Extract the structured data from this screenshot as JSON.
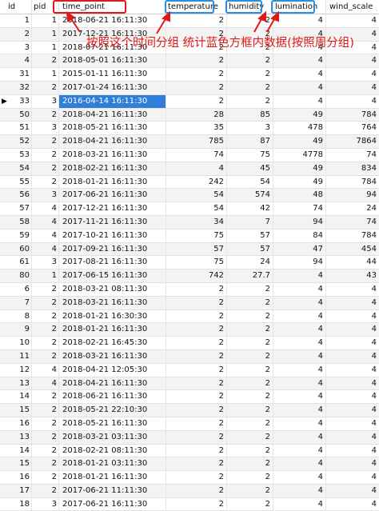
{
  "columns": {
    "id": "id",
    "pid": "pid",
    "time_point": "time_point",
    "temperature": "temperature",
    "humidity": "humidity",
    "lumination": "lumination",
    "wind_scale": "wind_scale"
  },
  "annotation": "按照这个时间分组 统计蓝色方框内数据(按照周分组)",
  "selected_row_index": 6,
  "highlight_colors": {
    "time_point_box": "#e01818",
    "data_boxes": "#2a8fe0",
    "selection": "#2f7fd8",
    "annotation_text": "#e01818"
  },
  "rows": [
    {
      "id": "1",
      "pid": "1",
      "time_point": "2018-06-21 16:11:30",
      "temperature": "2",
      "humidity": "2",
      "lumination": "4",
      "wind_scale": "4"
    },
    {
      "id": "2",
      "pid": "1",
      "time_point": "2017-12-21 16:11:30",
      "temperature": "2",
      "humidity": "2",
      "lumination": "4",
      "wind_scale": "4"
    },
    {
      "id": "3",
      "pid": "1",
      "time_point": "2018-07-21 16:11:30",
      "temperature": "2",
      "humidity": "2",
      "lumination": "4",
      "wind_scale": "4"
    },
    {
      "id": "4",
      "pid": "2",
      "time_point": "2018-05-01 16:11:30",
      "temperature": "2",
      "humidity": "2",
      "lumination": "4",
      "wind_scale": "4"
    },
    {
      "id": "31",
      "pid": "1",
      "time_point": "2015-01-11 16:11:30",
      "temperature": "2",
      "humidity": "2",
      "lumination": "4",
      "wind_scale": "4"
    },
    {
      "id": "32",
      "pid": "2",
      "time_point": "2017-01-24 16:11:30",
      "temperature": "2",
      "humidity": "2",
      "lumination": "4",
      "wind_scale": "4"
    },
    {
      "id": "33",
      "pid": "3",
      "time_point": "2016-04-14 16:11:30",
      "temperature": "2",
      "humidity": "2",
      "lumination": "4",
      "wind_scale": "4"
    },
    {
      "id": "50",
      "pid": "2",
      "time_point": "2018-04-21 16:11:30",
      "temperature": "28",
      "humidity": "85",
      "lumination": "49",
      "wind_scale": "784"
    },
    {
      "id": "51",
      "pid": "3",
      "time_point": "2018-05-21 16:11:30",
      "temperature": "35",
      "humidity": "3",
      "lumination": "478",
      "wind_scale": "764"
    },
    {
      "id": "52",
      "pid": "2",
      "time_point": "2018-04-21 16:11:30",
      "temperature": "785",
      "humidity": "87",
      "lumination": "49",
      "wind_scale": "7864"
    },
    {
      "id": "53",
      "pid": "2",
      "time_point": "2018-03-21 16:11:30",
      "temperature": "74",
      "humidity": "75",
      "lumination": "4778",
      "wind_scale": "74"
    },
    {
      "id": "54",
      "pid": "2",
      "time_point": "2018-02-21 16:11:30",
      "temperature": "4",
      "humidity": "45",
      "lumination": "49",
      "wind_scale": "834"
    },
    {
      "id": "55",
      "pid": "2",
      "time_point": "2018-01-21 16:11:30",
      "temperature": "242",
      "humidity": "54",
      "lumination": "49",
      "wind_scale": "784"
    },
    {
      "id": "56",
      "pid": "3",
      "time_point": "2017-06-21 16:11:30",
      "temperature": "54",
      "humidity": "574",
      "lumination": "48",
      "wind_scale": "94"
    },
    {
      "id": "57",
      "pid": "4",
      "time_point": "2017-12-21 16:11:30",
      "temperature": "54",
      "humidity": "42",
      "lumination": "74",
      "wind_scale": "24"
    },
    {
      "id": "58",
      "pid": "4",
      "time_point": "2017-11-21 16:11:30",
      "temperature": "34",
      "humidity": "7",
      "lumination": "94",
      "wind_scale": "74"
    },
    {
      "id": "59",
      "pid": "4",
      "time_point": "2017-10-21 16:11:30",
      "temperature": "75",
      "humidity": "57",
      "lumination": "84",
      "wind_scale": "784"
    },
    {
      "id": "60",
      "pid": "4",
      "time_point": "2017-09-21 16:11:30",
      "temperature": "57",
      "humidity": "57",
      "lumination": "47",
      "wind_scale": "454"
    },
    {
      "id": "61",
      "pid": "3",
      "time_point": "2017-08-21 16:11:30",
      "temperature": "75",
      "humidity": "24",
      "lumination": "94",
      "wind_scale": "44"
    },
    {
      "id": "80",
      "pid": "1",
      "time_point": "2017-06-15 16:11:30",
      "temperature": "742",
      "humidity": "27.7",
      "lumination": "4",
      "wind_scale": "43"
    },
    {
      "id": "6",
      "pid": "2",
      "time_point": "2018-03-21 08:11:30",
      "temperature": "2",
      "humidity": "2",
      "lumination": "4",
      "wind_scale": "4"
    },
    {
      "id": "7",
      "pid": "2",
      "time_point": "2018-03-21 16:11:30",
      "temperature": "2",
      "humidity": "2",
      "lumination": "4",
      "wind_scale": "4"
    },
    {
      "id": "8",
      "pid": "2",
      "time_point": "2018-01-21 16:30:30",
      "temperature": "2",
      "humidity": "2",
      "lumination": "4",
      "wind_scale": "4"
    },
    {
      "id": "9",
      "pid": "2",
      "time_point": "2018-01-21 16:11:30",
      "temperature": "2",
      "humidity": "2",
      "lumination": "4",
      "wind_scale": "4"
    },
    {
      "id": "10",
      "pid": "2",
      "time_point": "2018-02-21 16:45:30",
      "temperature": "2",
      "humidity": "2",
      "lumination": "4",
      "wind_scale": "4"
    },
    {
      "id": "11",
      "pid": "2",
      "time_point": "2018-03-21 16:11:30",
      "temperature": "2",
      "humidity": "2",
      "lumination": "4",
      "wind_scale": "4"
    },
    {
      "id": "12",
      "pid": "4",
      "time_point": "2018-04-21 12:05:30",
      "temperature": "2",
      "humidity": "2",
      "lumination": "4",
      "wind_scale": "4"
    },
    {
      "id": "13",
      "pid": "4",
      "time_point": "2018-04-21 16:11:30",
      "temperature": "2",
      "humidity": "2",
      "lumination": "4",
      "wind_scale": "4"
    },
    {
      "id": "14",
      "pid": "2",
      "time_point": "2018-06-21 16:11:30",
      "temperature": "2",
      "humidity": "2",
      "lumination": "4",
      "wind_scale": "4"
    },
    {
      "id": "15",
      "pid": "2",
      "time_point": "2018-05-21 22:10:30",
      "temperature": "2",
      "humidity": "2",
      "lumination": "4",
      "wind_scale": "4"
    },
    {
      "id": "16",
      "pid": "2",
      "time_point": "2018-05-21 16:11:30",
      "temperature": "2",
      "humidity": "2",
      "lumination": "4",
      "wind_scale": "4"
    },
    {
      "id": "13",
      "pid": "2",
      "time_point": "2018-03-21 03:11:30",
      "temperature": "2",
      "humidity": "2",
      "lumination": "4",
      "wind_scale": "4"
    },
    {
      "id": "14",
      "pid": "2",
      "time_point": "2018-02-21 08:11:30",
      "temperature": "2",
      "humidity": "2",
      "lumination": "4",
      "wind_scale": "4"
    },
    {
      "id": "15",
      "pid": "2",
      "time_point": "2018-01-21 03:11:30",
      "temperature": "2",
      "humidity": "2",
      "lumination": "4",
      "wind_scale": "4"
    },
    {
      "id": "16",
      "pid": "2",
      "time_point": "2018-01-21 16:11:30",
      "temperature": "2",
      "humidity": "2",
      "lumination": "4",
      "wind_scale": "4"
    },
    {
      "id": "17",
      "pid": "2",
      "time_point": "2017-06-21 11:11:30",
      "temperature": "2",
      "humidity": "2",
      "lumination": "4",
      "wind_scale": "4"
    },
    {
      "id": "18",
      "pid": "3",
      "time_point": "2017-06-21 16:11:30",
      "temperature": "2",
      "humidity": "2",
      "lumination": "4",
      "wind_scale": "4"
    }
  ]
}
